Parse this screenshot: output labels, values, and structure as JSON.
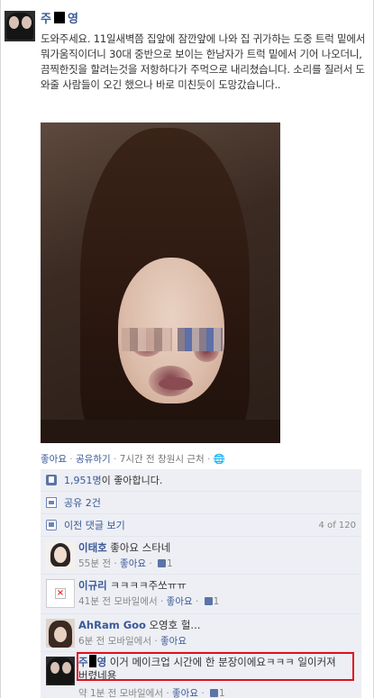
{
  "post": {
    "author_first": "주",
    "author_last": "영",
    "text": "도와주세요. 11일새벽쯤 집앞에 잠깐앞에 나와 집 귀가하는 도중 트럭 밑에서 뭐가움직이더니 30대 중반으로 보이는 한남자가 트럭 밑에서 기어 나오더니, 끔찍한짓을 할려는것을 저항하다가 주먹으로 내리쳤습니다. 소리를 질러서 도와줄 사람들이 오긴 했으나 바로 미친듯이 도망갔습니다..",
    "actions": {
      "like": "좋아요",
      "share": "공유하기",
      "time": "7시간 전",
      "location": "창원시 근처"
    }
  },
  "ufi": {
    "likes_count": "1,951명",
    "likes_suffix": "이 좋아합니다.",
    "shares": "공유 2건",
    "prev_comments": "이전 댓글 보기",
    "comment_counter": "4 of 120"
  },
  "comments": [
    {
      "name": "이태호",
      "text": "좋아요 스타네",
      "time": "55분 전",
      "like": "좋아요",
      "likes": "1"
    },
    {
      "name": "이규리",
      "text": "ㅋㅋㅋㅋ주쏘ㅠㅠ",
      "time": "41분 전 모바일에서",
      "like": "좋아요",
      "likes": "1"
    },
    {
      "name": "AhRam Goo",
      "text": "오영호 헐...",
      "time": "6분 전 모바일에서",
      "like": "좋아요"
    },
    {
      "name_first": "주",
      "name_last": "영",
      "text": "이거 메이크업 시간에 한 분장이에요ㅋㅋㅋ 일이커져버렸네용",
      "time": "약 1분 전 모바일에서",
      "like": "좋아요",
      "likes": "1"
    }
  ],
  "colors": {
    "link": "#3b5998",
    "ufi_bg": "#edeff4",
    "highlight": "#e0101a"
  }
}
